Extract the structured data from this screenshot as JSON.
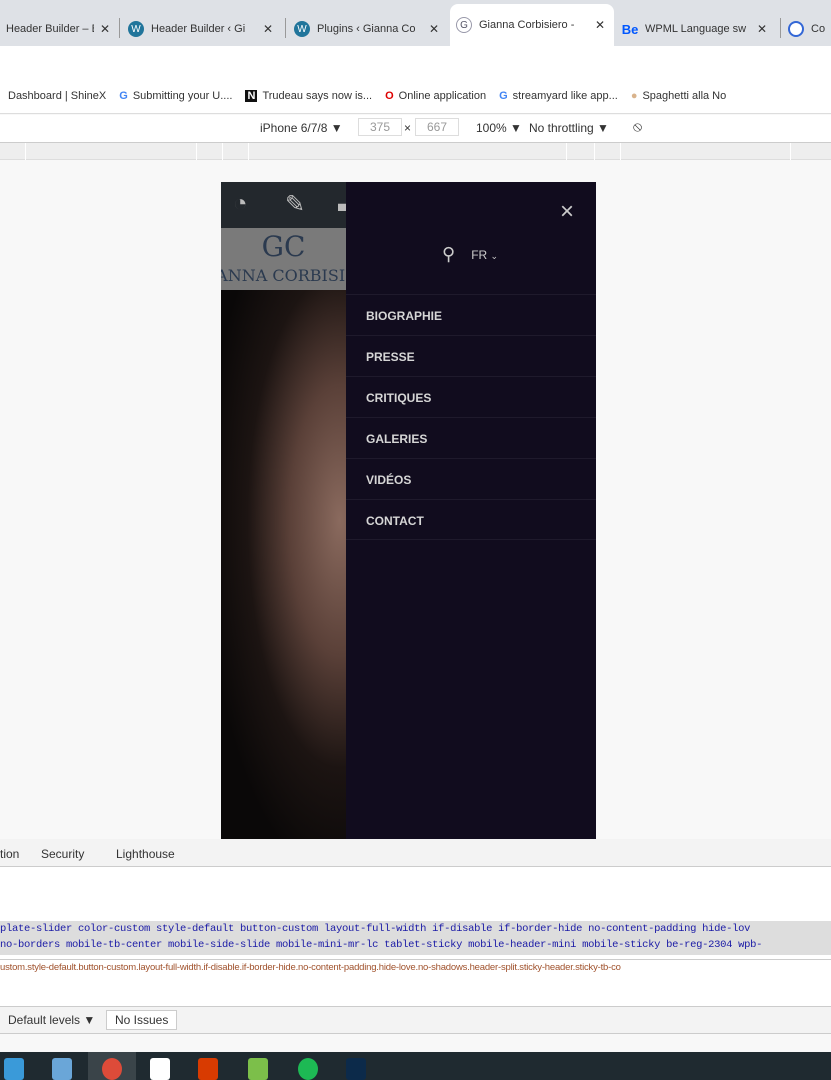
{
  "browser": {
    "tabs": [
      {
        "title": "Header Builder – Be",
        "active": false
      },
      {
        "title": "Header Builder ‹ Gi",
        "active": false
      },
      {
        "title": "Plugins ‹ Gianna Co",
        "active": false
      },
      {
        "title": "Gianna Corbisiero -",
        "active": true
      },
      {
        "title": "WPML Language sw",
        "active": false
      },
      {
        "title": "Cor",
        "active": false
      }
    ],
    "bookmarks": [
      "Dashboard | ShineX",
      "Submitting your U....",
      "Trudeau says now is...",
      "Online application",
      "streamyard like app...",
      "Spaghetti alla No"
    ]
  },
  "devtools_toolbar": {
    "device": "iPhone 6/7/8 ▼",
    "width": "375",
    "x": "×",
    "height": "667",
    "zoom": "100% ▼",
    "throttling": "No throttling ▼"
  },
  "site": {
    "logo_monogram": "GC",
    "logo_text": "IANNA CORBISI",
    "close_icon": "×",
    "language": "FR",
    "menu": [
      "BIOGRAPHIE",
      "PRESSE",
      "CRITIQUES",
      "GALERIES",
      "VIDÉOS",
      "CONTACT"
    ],
    "menu_bg": "#110c1e"
  },
  "devtools": {
    "tabs": [
      "tion",
      "Security",
      "Lighthouse"
    ],
    "code_line1": "plate-slider  color-custom style-default button-custom layout-full-width if-disable if-border-hide no-content-padding hide-lov",
    "code_line2": "no-borders mobile-tb-center mobile-side-slide mobile-mini-mr-lc tablet-sticky mobile-header-mini mobile-sticky be-reg-2304 wpb-",
    "selector_line": "ustom.style-default.button-custom.layout-full-width.if-disable.if-border-hide.no-content-padding.hide-love.no-shadows.header-split.sticky-header.sticky-tb-co",
    "levels": "Default levels ▼",
    "issues": "No Issues"
  }
}
